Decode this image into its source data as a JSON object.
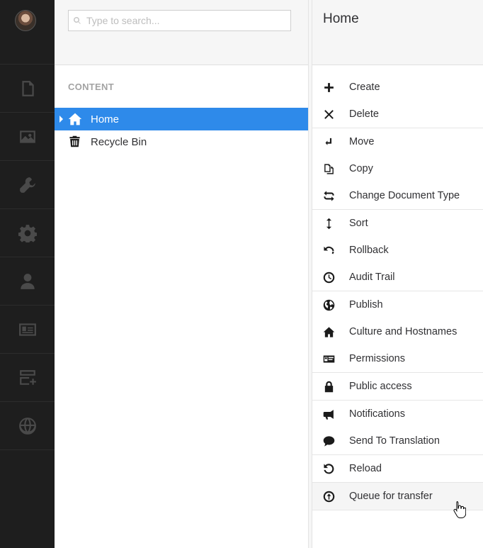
{
  "search": {
    "placeholder": "Type to search..."
  },
  "tree": {
    "section_title": "CONTENT",
    "nodes": [
      {
        "label": "Home",
        "active": true
      },
      {
        "label": "Recycle Bin",
        "active": false
      }
    ]
  },
  "actions": {
    "title": "Home",
    "items": [
      {
        "label": "Create",
        "icon": "plus-icon"
      },
      {
        "label": "Delete",
        "icon": "x-icon"
      },
      {
        "label": "Move",
        "icon": "move-arrow-icon"
      },
      {
        "label": "Copy",
        "icon": "copy-icon"
      },
      {
        "label": "Change Document Type",
        "icon": "swap-icon"
      },
      {
        "label": "Sort",
        "icon": "sort-icon"
      },
      {
        "label": "Rollback",
        "icon": "undo-icon"
      },
      {
        "label": "Audit Trail",
        "icon": "clock-icon"
      },
      {
        "label": "Publish",
        "icon": "globe-icon"
      },
      {
        "label": "Culture and Hostnames",
        "icon": "home-icon"
      },
      {
        "label": "Permissions",
        "icon": "id-card-icon"
      },
      {
        "label": "Public access",
        "icon": "lock-icon"
      },
      {
        "label": "Notifications",
        "icon": "megaphone-icon"
      },
      {
        "label": "Send To Translation",
        "icon": "speech-bubble-icon"
      },
      {
        "label": "Reload",
        "icon": "reload-icon"
      },
      {
        "label": "Queue for transfer",
        "icon": "upload-circle-icon"
      }
    ]
  },
  "colors": {
    "accent": "#2e8aea",
    "rail": "#1e1e1e",
    "rail_icon": "#4a4a4a"
  }
}
